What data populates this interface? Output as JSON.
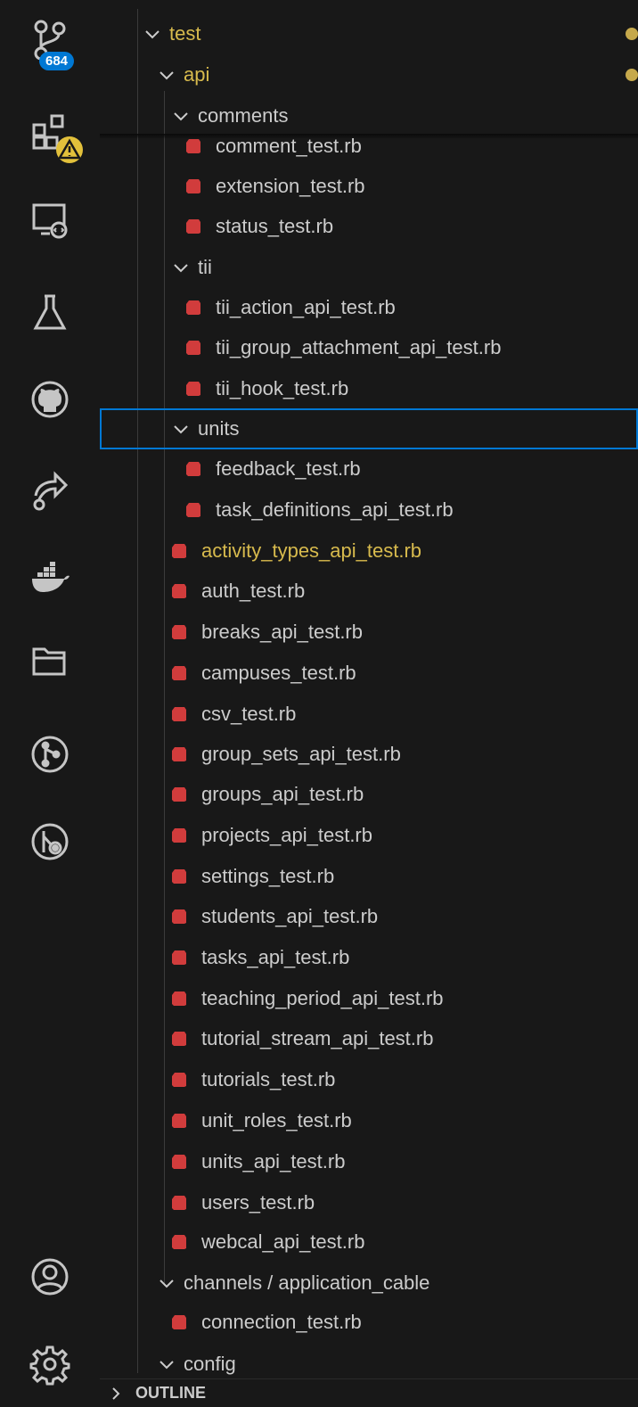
{
  "activity_bar": {
    "items": [
      {
        "icon": "source-control-icon",
        "badge": "684"
      },
      {
        "icon": "extensions-icon",
        "warning": true
      },
      {
        "icon": "remote-explorer-icon"
      },
      {
        "icon": "testing-icon"
      },
      {
        "icon": "github-icon"
      },
      {
        "icon": "live-share-icon"
      },
      {
        "icon": "docker-icon"
      },
      {
        "icon": "folder-explorer-icon"
      },
      {
        "icon": "git-graph-icon"
      },
      {
        "icon": "gitlens-inspect-icon"
      }
    ],
    "bottom": [
      {
        "icon": "account-icon"
      },
      {
        "icon": "manage-gear-icon"
      }
    ]
  },
  "tree": {
    "rows": [
      {
        "label": "test",
        "type": "folder",
        "modified": true
      },
      {
        "label": "api",
        "type": "folder",
        "modified": true
      },
      {
        "label": "comments",
        "type": "folder"
      },
      {
        "label": "comment_test.rb",
        "type": "file"
      },
      {
        "label": "extension_test.rb",
        "type": "file"
      },
      {
        "label": "status_test.rb",
        "type": "file"
      },
      {
        "label": "tii",
        "type": "folder"
      },
      {
        "label": "tii_action_api_test.rb",
        "type": "file"
      },
      {
        "label": "tii_group_attachment_api_test.rb",
        "type": "file"
      },
      {
        "label": "tii_hook_test.rb",
        "type": "file"
      },
      {
        "label": "units",
        "type": "folder",
        "selected": true
      },
      {
        "label": "feedback_test.rb",
        "type": "file"
      },
      {
        "label": "task_definitions_api_test.rb",
        "type": "file"
      },
      {
        "label": "activity_types_api_test.rb",
        "type": "file",
        "modified": true
      },
      {
        "label": "auth_test.rb",
        "type": "file"
      },
      {
        "label": "breaks_api_test.rb",
        "type": "file"
      },
      {
        "label": "campuses_test.rb",
        "type": "file"
      },
      {
        "label": "csv_test.rb",
        "type": "file"
      },
      {
        "label": "group_sets_api_test.rb",
        "type": "file"
      },
      {
        "label": "groups_api_test.rb",
        "type": "file"
      },
      {
        "label": "projects_api_test.rb",
        "type": "file"
      },
      {
        "label": "settings_test.rb",
        "type": "file"
      },
      {
        "label": "students_api_test.rb",
        "type": "file"
      },
      {
        "label": "tasks_api_test.rb",
        "type": "file"
      },
      {
        "label": "teaching_period_api_test.rb",
        "type": "file"
      },
      {
        "label": "tutorial_stream_api_test.rb",
        "type": "file"
      },
      {
        "label": "tutorials_test.rb",
        "type": "file"
      },
      {
        "label": "unit_roles_test.rb",
        "type": "file"
      },
      {
        "label": "units_api_test.rb",
        "type": "file"
      },
      {
        "label": "users_test.rb",
        "type": "file"
      },
      {
        "label": "webcal_api_test.rb",
        "type": "file"
      },
      {
        "label": "channels / application_cable",
        "type": "folder"
      },
      {
        "label": "connection_test.rb",
        "type": "file"
      },
      {
        "label": "config",
        "type": "folder"
      }
    ]
  },
  "outline": {
    "label": "OUTLINE"
  },
  "colors": {
    "background": "#181818",
    "text": "#cccccc",
    "modified": "#d7ba4d",
    "ruby_icon": "#d13c3c",
    "focus": "#0078d4",
    "badge": "#0078d4",
    "warning": "#e2c03b"
  }
}
